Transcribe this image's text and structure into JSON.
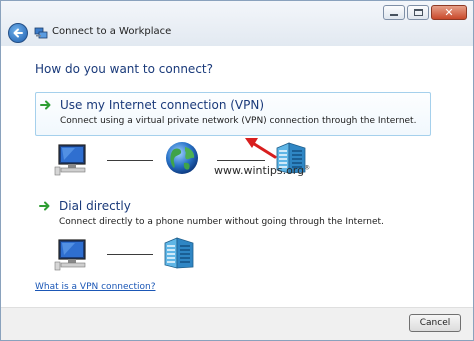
{
  "window": {
    "title": "Connect to a Workplace",
    "close_glyph": "✕"
  },
  "heading": "How do you want to connect?",
  "options": [
    {
      "title": "Use my Internet connection (VPN)",
      "description": "Connect using a virtual private network (VPN) connection through the Internet.",
      "selected": true
    },
    {
      "title": "Dial directly",
      "description": "Connect directly to a phone number without going through the Internet.",
      "selected": false
    }
  ],
  "watermark": {
    "text": "www.wintips.org",
    "mark": "®"
  },
  "help_link": "What is a VPN connection?",
  "footer": {
    "cancel_label": "Cancel"
  },
  "colors": {
    "heading": "#1a3a7a",
    "link": "#1b57b6",
    "option_border": "#a5d0ec",
    "arrow_green": "#2f9e33",
    "annotation_red": "#d81e1e"
  }
}
